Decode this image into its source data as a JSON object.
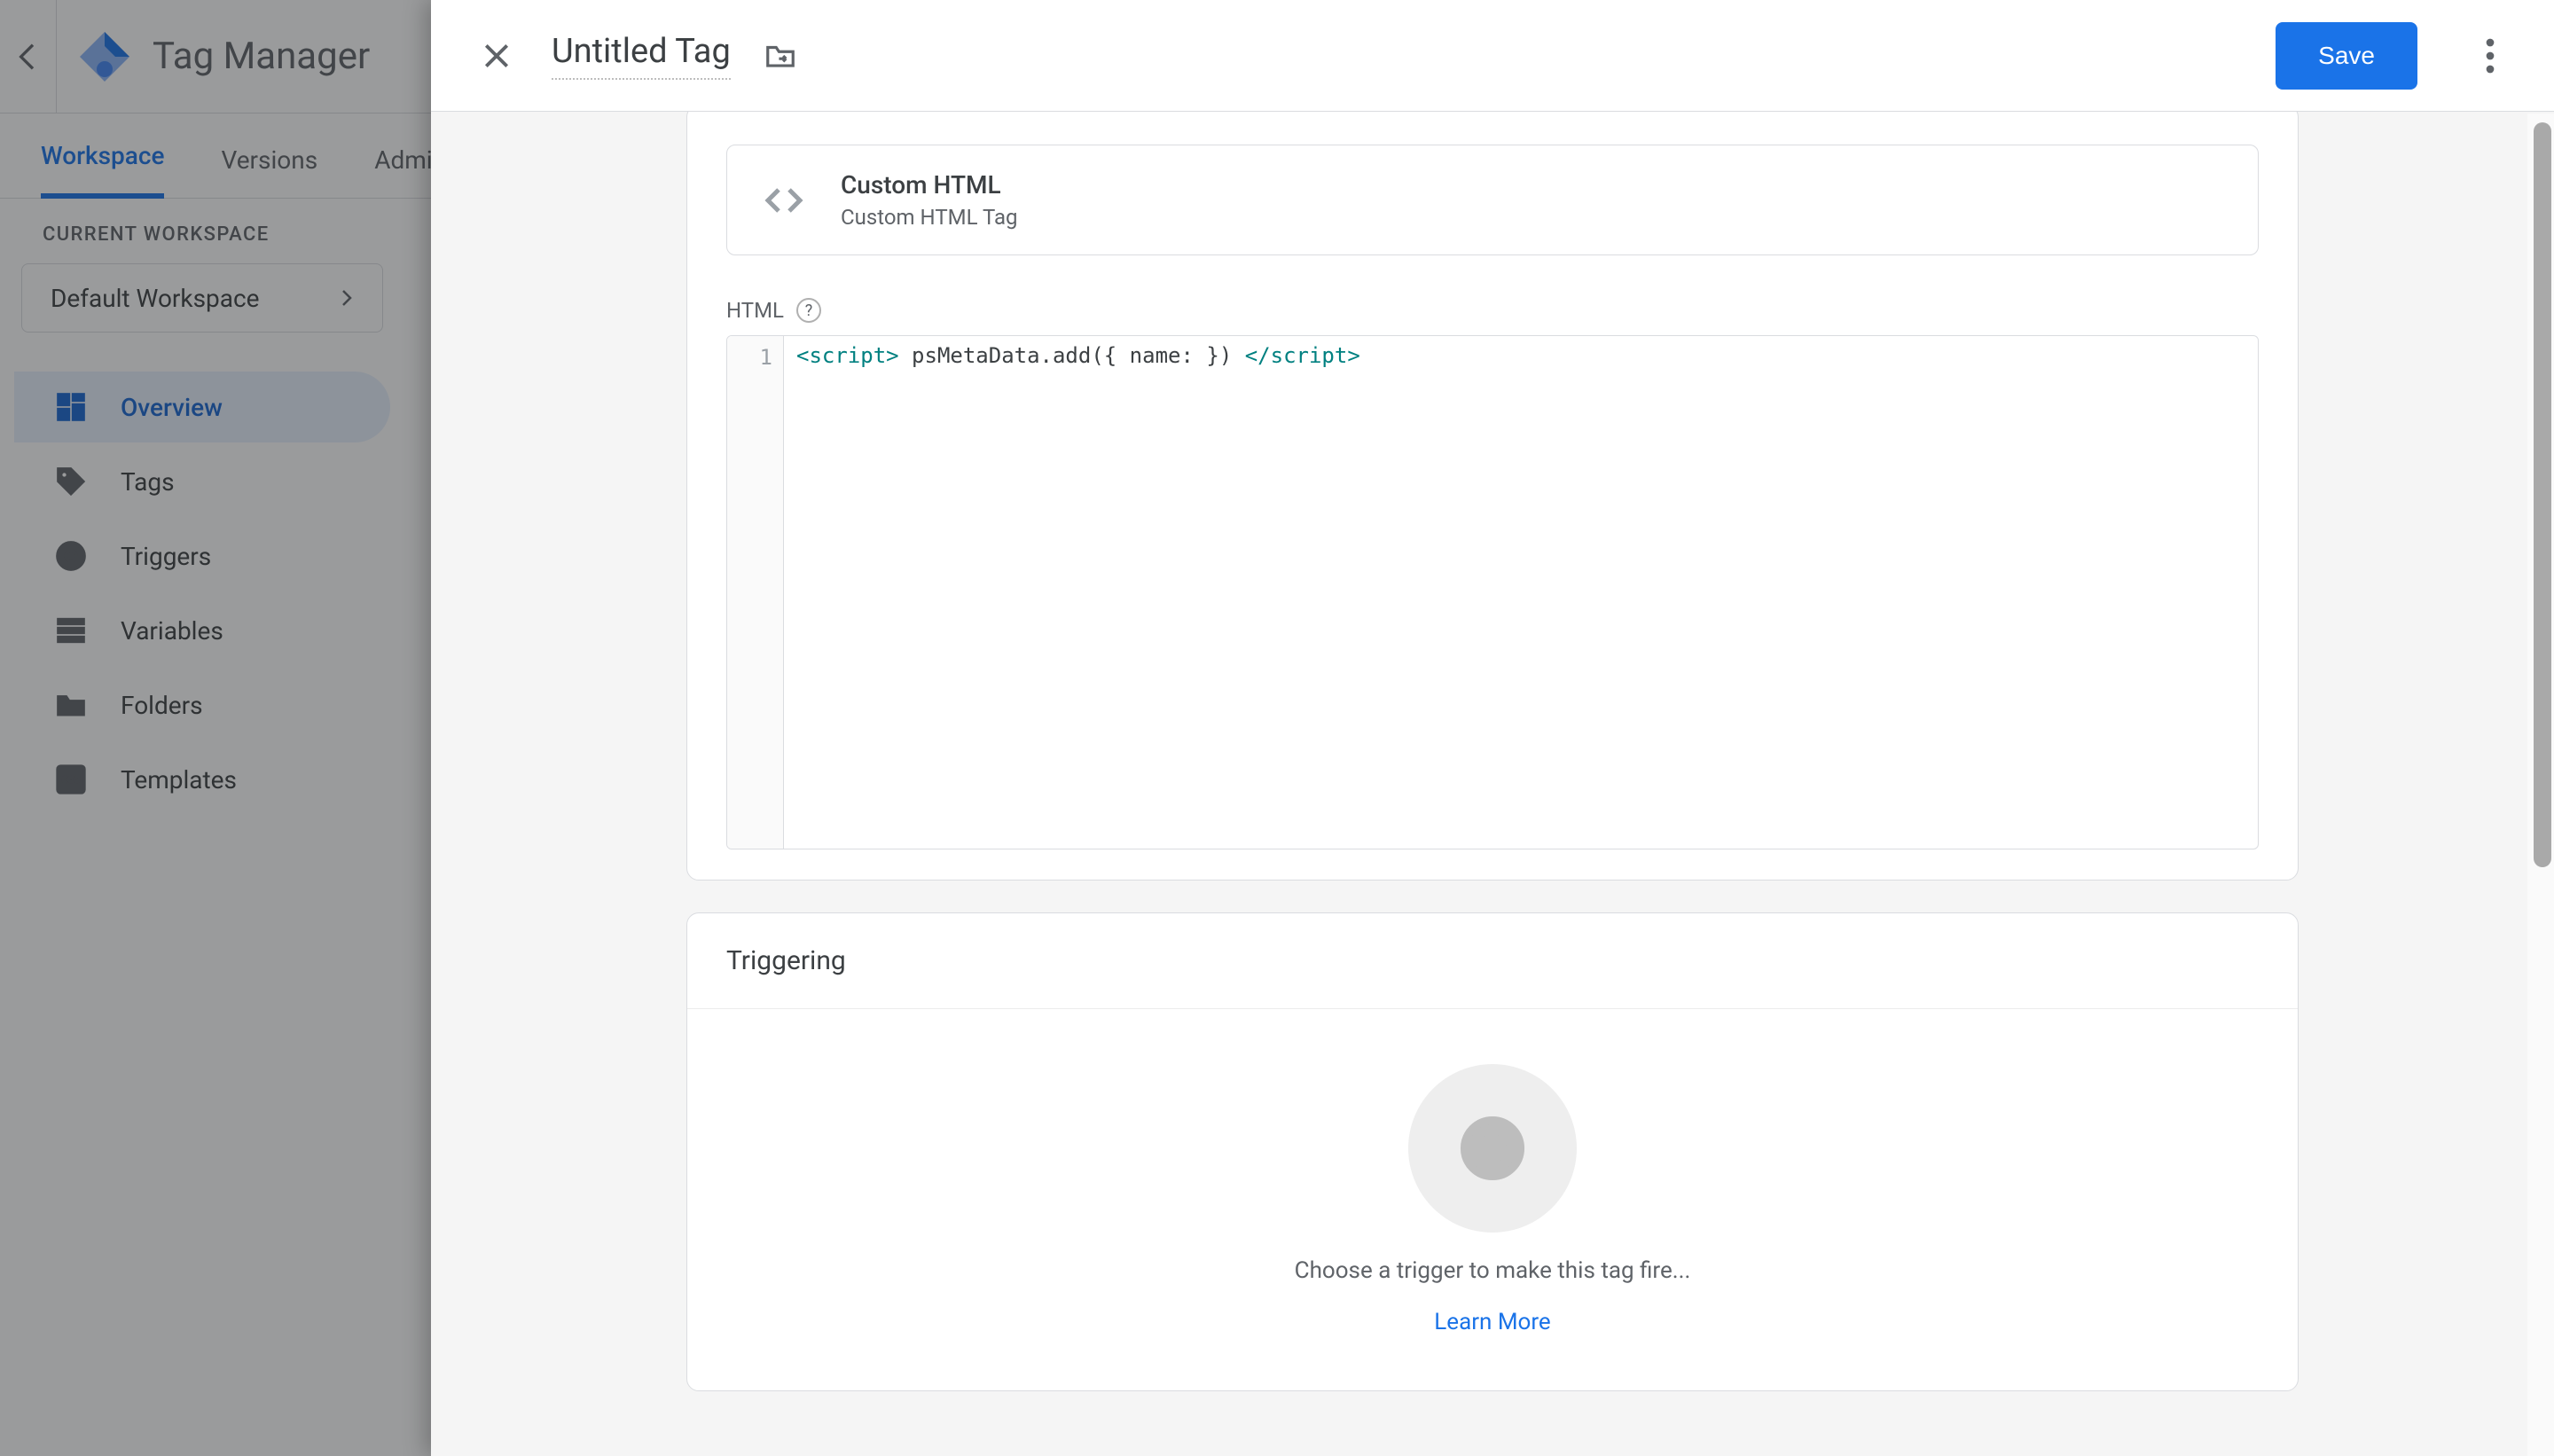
{
  "app": {
    "title": "Tag Manager"
  },
  "tabs": {
    "workspace": "Workspace",
    "versions": "Versions",
    "admin": "Admin"
  },
  "sidebar": {
    "current_label": "CURRENT WORKSPACE",
    "workspace_name": "Default Workspace",
    "items": [
      {
        "label": "Overview"
      },
      {
        "label": "Tags"
      },
      {
        "label": "Triggers"
      },
      {
        "label": "Variables"
      },
      {
        "label": "Folders"
      },
      {
        "label": "Templates"
      }
    ]
  },
  "modal": {
    "title": "Untitled Tag",
    "save_label": "Save",
    "tag_type": {
      "title": "Custom HTML",
      "subtitle": "Custom HTML Tag"
    },
    "html_section_label": "HTML",
    "code_line_number": "1",
    "code_tokens": {
      "open": "<script>",
      "body": " psMetaData.add({ name: }) ",
      "close": "</script>"
    },
    "triggering": {
      "heading": "Triggering",
      "empty_msg": "Choose a trigger to make this tag fire...",
      "learn_more": "Learn More"
    }
  }
}
